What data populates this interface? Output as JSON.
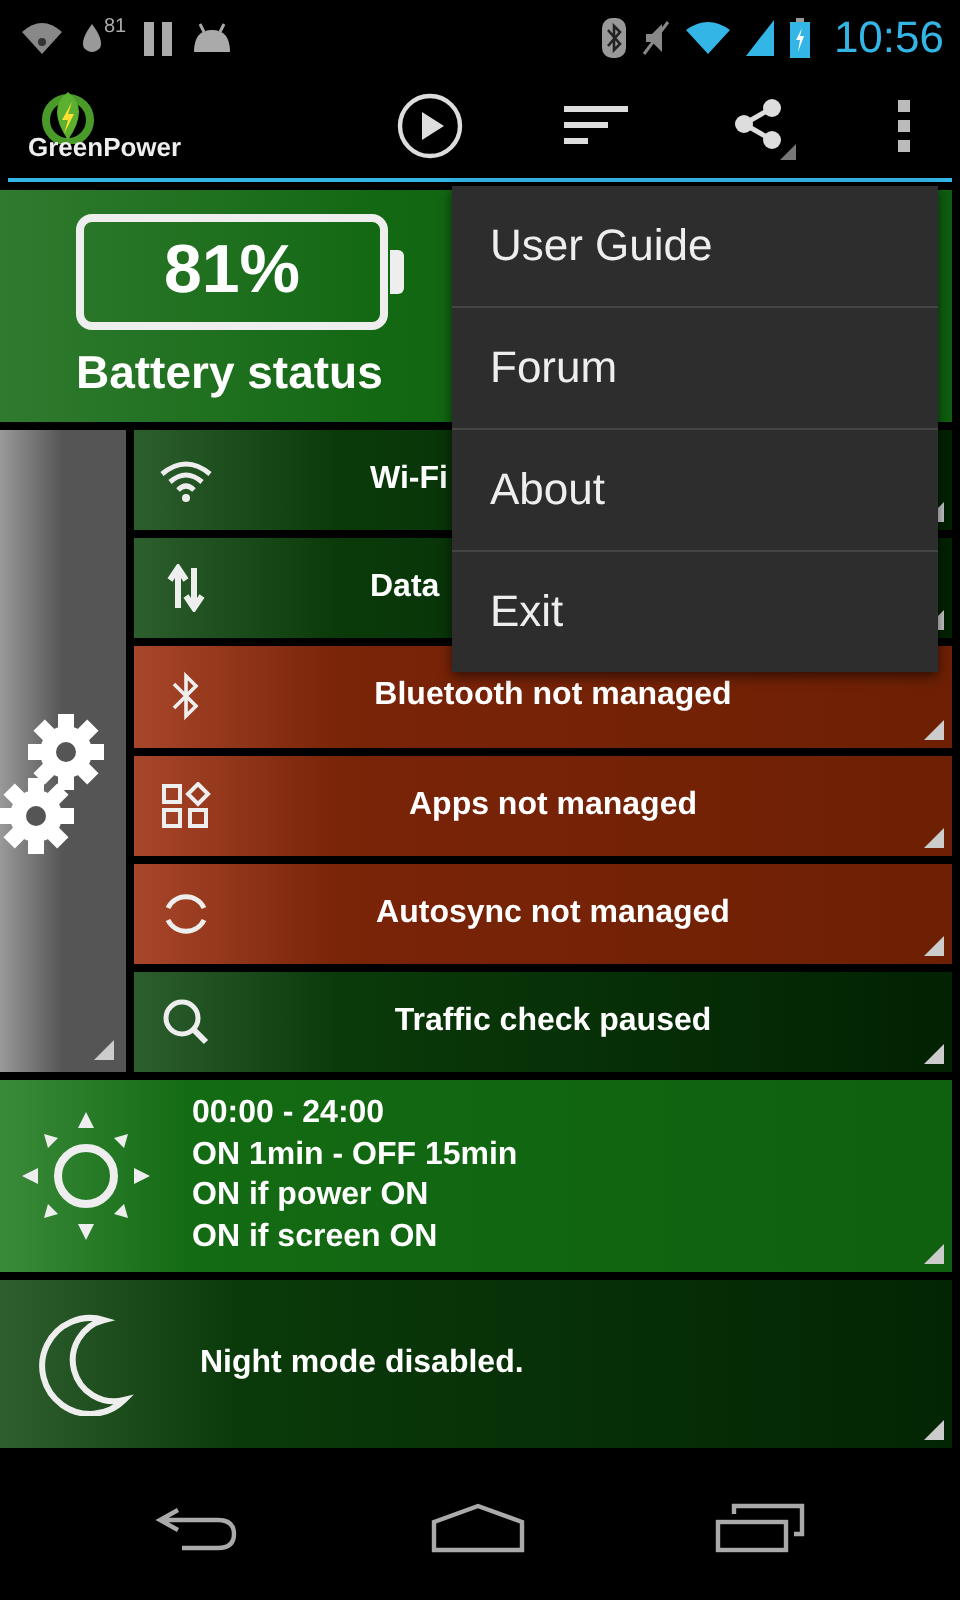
{
  "status_bar": {
    "notification_badge": "81",
    "time": "10:56"
  },
  "action_bar": {
    "app_name": "GreenPower"
  },
  "battery": {
    "percent": "81%",
    "label": "Battery status"
  },
  "rows": [
    {
      "label": "Wi-Fi",
      "managed": true
    },
    {
      "label": "Data",
      "managed": true
    },
    {
      "label": "Bluetooth not managed",
      "managed": false
    },
    {
      "label": "Apps not managed",
      "managed": false
    },
    {
      "label": "Autosync not managed",
      "managed": false
    },
    {
      "label": "Traffic check paused",
      "managed": true
    }
  ],
  "schedule": {
    "lines": [
      "00:00 - 24:00",
      "ON 1min - OFF 15min",
      "ON if power ON",
      "ON if screen ON"
    ]
  },
  "night": {
    "label": "Night mode disabled."
  },
  "menu": {
    "items": [
      {
        "label": "User Guide"
      },
      {
        "label": "Forum"
      },
      {
        "label": "About"
      },
      {
        "label": "Exit"
      }
    ]
  }
}
